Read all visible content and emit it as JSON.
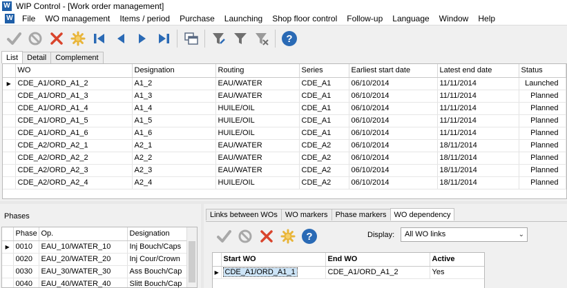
{
  "window": {
    "title": "WIP Control - [Work order management]",
    "logo_letter": "W"
  },
  "menu": [
    "File",
    "WO management",
    "Items / period",
    "Purchase",
    "Launching",
    "Shop floor control",
    "Follow-up",
    "Language",
    "Window",
    "Help"
  ],
  "toolbar": {
    "buttons": [
      "check-icon",
      "cancel-circle-icon",
      "delete-x-icon",
      "settings-gear-icon",
      "first-record-icon",
      "previous-record-icon",
      "next-record-icon",
      "last-record-icon",
      "window-icon",
      "filter-edit-icon",
      "filter-icon",
      "filter-clear-icon",
      "help-icon"
    ]
  },
  "top_tabs": [
    "List",
    "Detail",
    "Complement"
  ],
  "main_grid": {
    "columns": [
      "WO",
      "Designation",
      "Routing",
      "Series",
      "Earliest start date",
      "Latest end date",
      "Status"
    ],
    "rows": [
      [
        "CDE_A1/ORD_A1_2",
        "A1_2",
        "EAU/WATER",
        "CDE_A1",
        "06/10/2014",
        "11/11/2014",
        "Launched"
      ],
      [
        "CDE_A1/ORD_A1_3",
        "A1_3",
        "EAU/WATER",
        "CDE_A1",
        "06/10/2014",
        "11/11/2014",
        "Planned"
      ],
      [
        "CDE_A1/ORD_A1_4",
        "A1_4",
        "HUILE/OIL",
        "CDE_A1",
        "06/10/2014",
        "11/11/2014",
        "Planned"
      ],
      [
        "CDE_A1/ORD_A1_5",
        "A1_5",
        "HUILE/OIL",
        "CDE_A1",
        "06/10/2014",
        "11/11/2014",
        "Planned"
      ],
      [
        "CDE_A1/ORD_A1_6",
        "A1_6",
        "HUILE/OIL",
        "CDE_A1",
        "06/10/2014",
        "11/11/2014",
        "Planned"
      ],
      [
        "CDE_A2/ORD_A2_1",
        "A2_1",
        "EAU/WATER",
        "CDE_A2",
        "06/10/2014",
        "18/11/2014",
        "Planned"
      ],
      [
        "CDE_A2/ORD_A2_2",
        "A2_2",
        "EAU/WATER",
        "CDE_A2",
        "06/10/2014",
        "18/11/2014",
        "Planned"
      ],
      [
        "CDE_A2/ORD_A2_3",
        "A2_3",
        "EAU/WATER",
        "CDE_A2",
        "06/10/2014",
        "18/11/2014",
        "Planned"
      ],
      [
        "CDE_A2/ORD_A2_4",
        "A2_4",
        "HUILE/OIL",
        "CDE_A2",
        "06/10/2014",
        "18/11/2014",
        "Planned"
      ]
    ]
  },
  "phases": {
    "title": "Phases",
    "columns": [
      "Phase",
      "Op.",
      "Designation"
    ],
    "rows": [
      [
        "0010",
        "EAU_10/WATER_10",
        "Inj Bouch/Caps"
      ],
      [
        "0020",
        "EAU_20/WATER_20",
        "Inj Cour/Crown"
      ],
      [
        "0030",
        "EAU_30/WATER_30",
        "Ass Bouch/Cap"
      ],
      [
        "0040",
        "EAU_40/WATER_40",
        "Slitt Bouch/Cap"
      ]
    ]
  },
  "bottom_tabs": [
    "Links between WOs",
    "WO markers",
    "Phase markers",
    "WO dependency"
  ],
  "dependency": {
    "display_label": "Display:",
    "display_value": "All WO links",
    "columns": [
      "Start WO",
      "End WO",
      "Active"
    ],
    "rows": [
      [
        "CDE_A1/ORD_A1_1",
        "CDE_A1/ORD_A1_2",
        "Yes"
      ]
    ]
  },
  "colors": {
    "check": "#a8a8a8",
    "cancel": "#a8a8a8",
    "delete": "#d9442c",
    "gear": "#e8b53a",
    "nav": "#2a6ab5",
    "help": "#2a6ab5",
    "filter": "#6f6f6f",
    "logo": "#1f5fa8",
    "selection": "#cce4f7"
  }
}
